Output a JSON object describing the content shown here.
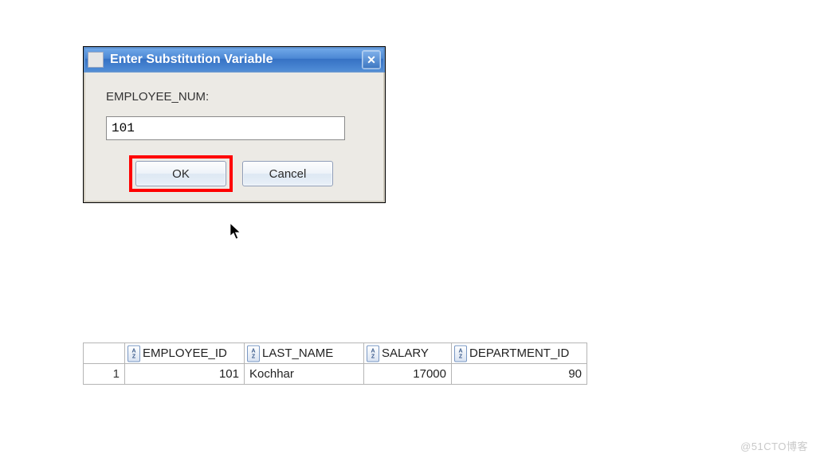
{
  "dialog": {
    "title": "Enter Substitution Variable",
    "close_glyph": "✕",
    "field_label": "EMPLOYEE_NUM:",
    "input_value": "101",
    "ok_label": "OK",
    "cancel_label": "Cancel"
  },
  "table": {
    "columns": [
      "EMPLOYEE_ID",
      "LAST_NAME",
      "SALARY",
      "DEPARTMENT_ID"
    ],
    "rows": [
      {
        "n": "1",
        "employee_id": "101",
        "last_name": "Kochhar",
        "salary": "17000",
        "department_id": "90"
      }
    ]
  },
  "watermark": "@51CTO博客"
}
